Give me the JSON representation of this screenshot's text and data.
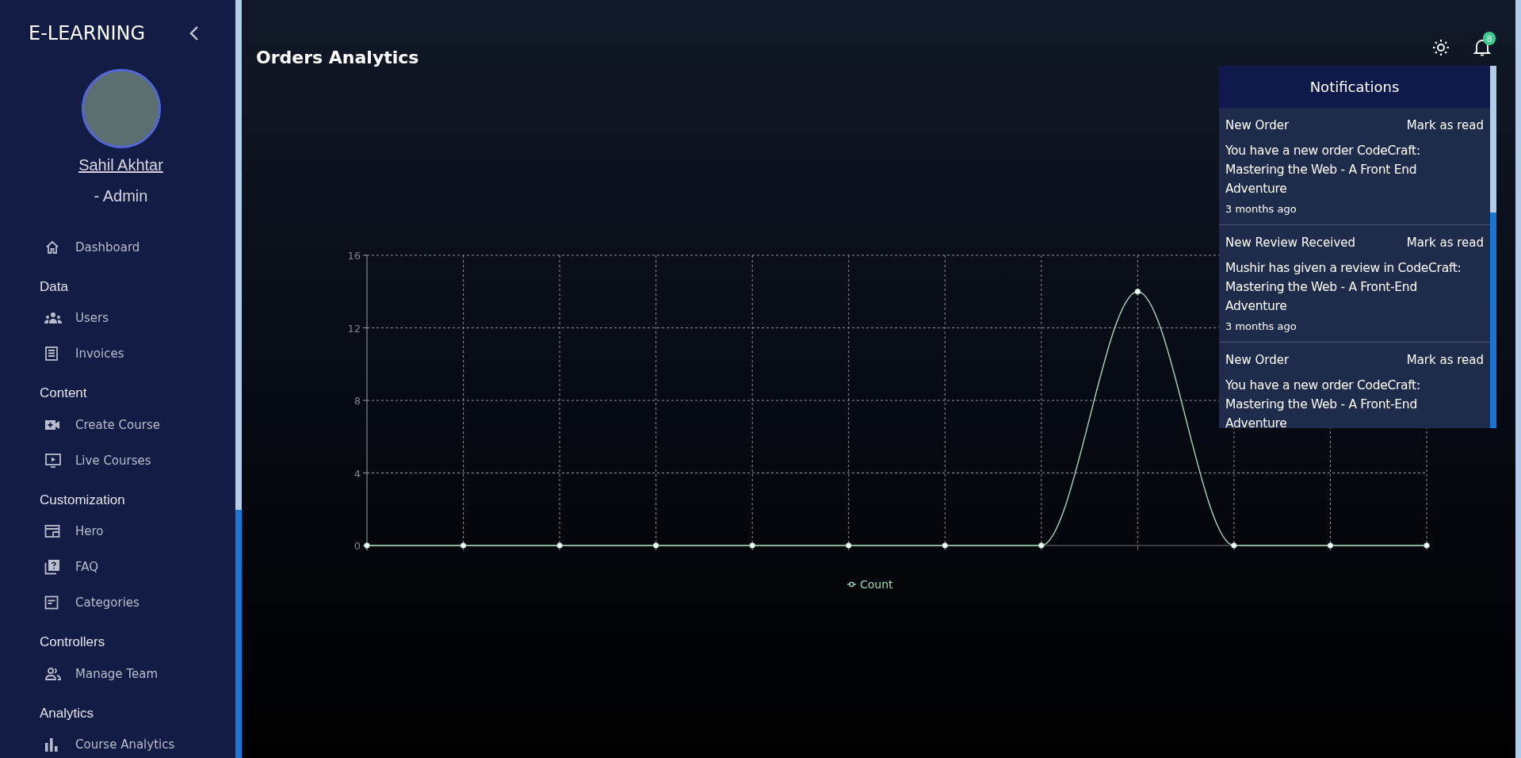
{
  "sidebar": {
    "brand": "E-LEARNING",
    "user_name": "Sahil Akhtar",
    "user_role": "- Admin",
    "nav": [
      {
        "kind": "item",
        "label": "Dashboard"
      },
      {
        "kind": "heading",
        "label": "Data"
      },
      {
        "kind": "item",
        "label": "Users"
      },
      {
        "kind": "item",
        "label": "Invoices"
      },
      {
        "kind": "heading",
        "label": "Content"
      },
      {
        "kind": "item",
        "label": "Create Course"
      },
      {
        "kind": "item",
        "label": "Live Courses"
      },
      {
        "kind": "heading",
        "label": "Customization"
      },
      {
        "kind": "item",
        "label": "Hero"
      },
      {
        "kind": "item",
        "label": "FAQ"
      },
      {
        "kind": "item",
        "label": "Categories"
      },
      {
        "kind": "heading",
        "label": "Controllers"
      },
      {
        "kind": "item",
        "label": "Manage Team"
      },
      {
        "kind": "heading",
        "label": "Analytics"
      },
      {
        "kind": "item",
        "label": "Course Analytics"
      }
    ]
  },
  "page": {
    "title": "Orders Analytics",
    "notification_count": "8"
  },
  "chart": {
    "chart_data": {
      "type": "line",
      "ylim": [
        0,
        16
      ],
      "yticks": [
        0,
        4,
        8,
        12,
        16
      ],
      "grid": true,
      "series": [
        {
          "name": "Count",
          "color": "#a3d9b8",
          "marker": "circle",
          "values": [
            0,
            0,
            0,
            0,
            0,
            0,
            0,
            0,
            14,
            0,
            0,
            0
          ]
        }
      ]
    }
  },
  "notifications": {
    "title": "Notifications",
    "items": [
      {
        "title": "New Order",
        "action": "Mark as read",
        "message": "You have a new order CodeCraft: Mastering the Web - A Front End Adventure",
        "time": "3 months ago"
      },
      {
        "title": "New Review Received",
        "action": "Mark as read",
        "message": "Mushir has given a review in CodeCraft: Mastering the Web - A Front-End Adventure",
        "time": "3 months ago"
      },
      {
        "title": "New Order",
        "action": "Mark as read",
        "message": "You have a new order CodeCraft: Mastering the Web - A Front-End Adventure"
      }
    ]
  }
}
